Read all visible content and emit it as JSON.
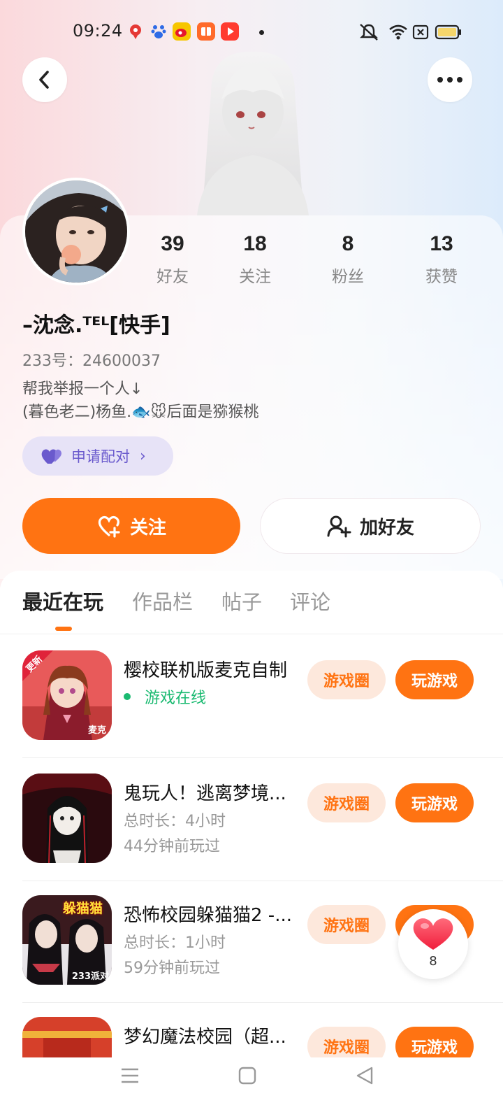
{
  "status_bar": {
    "time": "09:24"
  },
  "profile": {
    "name": "–沈念.ᵀᴱᴸ[快手]",
    "uid": "233号：24600037",
    "bio_line1": "帮我举报一个人↓",
    "bio_line2": "(暮色老二)杨鱼.🐟🐭后面是猕猴桃",
    "pair_label": "申请配对",
    "stats": [
      {
        "value": "39",
        "label": "好友"
      },
      {
        "value": "18",
        "label": "关注"
      },
      {
        "value": "8",
        "label": "粉丝"
      },
      {
        "value": "13",
        "label": "获赞"
      }
    ]
  },
  "actions": {
    "follow_label": "关注",
    "add_friend_label": "加好友"
  },
  "tabs": [
    {
      "label": "最近在玩",
      "active": true
    },
    {
      "label": "作品栏",
      "active": false
    },
    {
      "label": "帖子",
      "active": false
    },
    {
      "label": "评论",
      "active": false
    }
  ],
  "games": [
    {
      "title": "樱校联机版麦克自制",
      "status": "游戏在线",
      "circle_label": "游戏圈",
      "play_label": "玩游戏",
      "badge": "更新",
      "corner": "麦克"
    },
    {
      "title": "鬼玩人！逃离梦境...",
      "duration": "总时长：4小时",
      "last_played": "44分钟前玩过",
      "circle_label": "游戏圈",
      "play_label": "玩游戏"
    },
    {
      "title": "恐怖校园躲猫猫2 -...",
      "duration": "总时长：1小时",
      "last_played": "59分钟前玩过",
      "circle_label": "游戏圈",
      "play_label": "玩游戏",
      "icon_text": "躲猫猫",
      "corner": "233派对"
    },
    {
      "title": "梦幻魔法校园（超...",
      "circle_label": "游戏圈",
      "play_label": "玩游戏"
    }
  ],
  "like_float": {
    "count": "8"
  },
  "colors": {
    "accent": "#ff7312",
    "pair": "#6a5acd",
    "online": "#1aba71"
  }
}
